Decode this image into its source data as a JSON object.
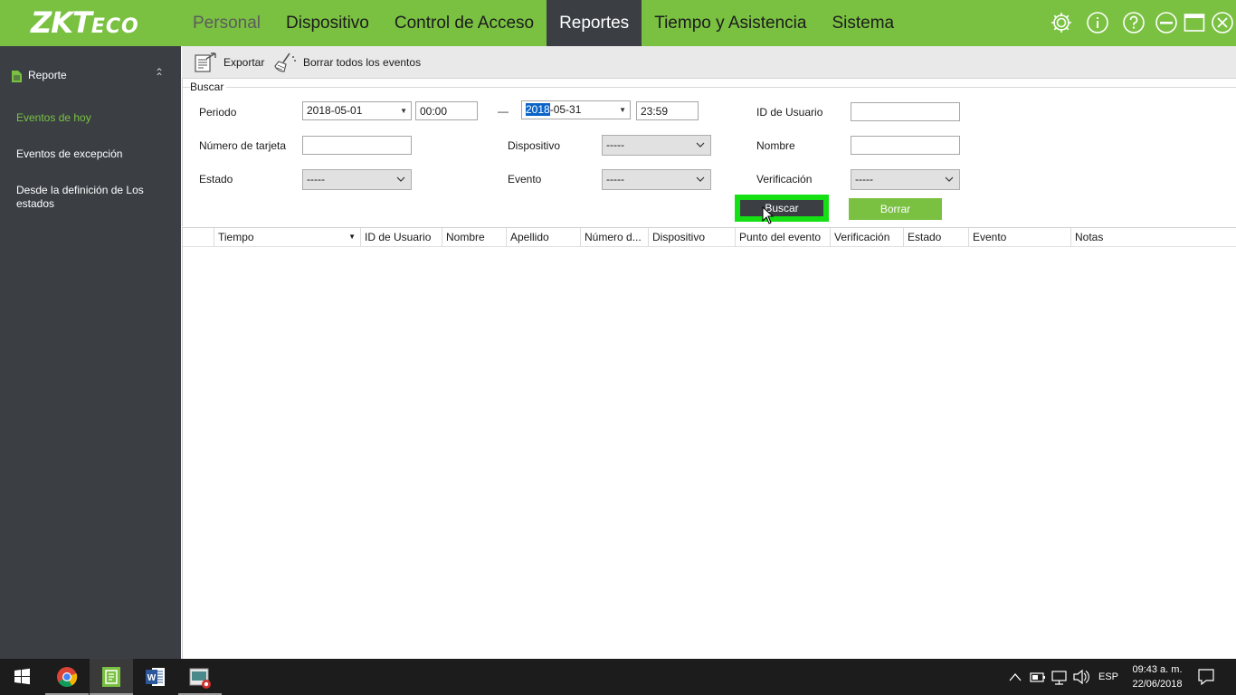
{
  "app": {
    "logo": {
      "main": "ZKT",
      "suffix": "ECO"
    },
    "accent_color": "#7ac142",
    "dark_color": "#3b3f44"
  },
  "nav": {
    "items": [
      {
        "label": "Personal"
      },
      {
        "label": "Dispositivo"
      },
      {
        "label": "Control de Acceso"
      },
      {
        "label": "Reportes"
      },
      {
        "label": "Tiempo y Asistencia"
      },
      {
        "label": "Sistema"
      }
    ],
    "active": "Reportes",
    "icons": [
      "gear-icon",
      "info-icon",
      "help-icon",
      "minimize-icon",
      "maximize-icon",
      "close-icon"
    ]
  },
  "sidebar": {
    "header": "Reporte",
    "items": [
      {
        "label": "Eventos de hoy",
        "active": true
      },
      {
        "label": "Eventos de excepción",
        "active": false
      },
      {
        "label": "Desde la definición de Los estados",
        "active": false
      }
    ]
  },
  "toolbar": {
    "export_label": "Exportar",
    "clear_label": "Borrar todos los eventos"
  },
  "search": {
    "legend": "Buscar",
    "periodo_label": "Periodo",
    "date_from": "2018-05-01",
    "time_from": "00:00",
    "range_dash": "—",
    "date_to_selected": "2018",
    "date_to_rest": "-05-31",
    "time_to": "23:59",
    "user_id_label": "ID de Usuario",
    "user_id_value": "",
    "card_label": "Número de tarjeta",
    "card_value": "",
    "device_label": "Dispositivo",
    "device_value": "-----",
    "name_label": "Nombre",
    "name_value": "",
    "state_label": "Estado",
    "state_value": "-----",
    "event_label": "Evento",
    "event_value": "-----",
    "verification_label": "Verificación",
    "verification_value": "-----",
    "search_button": "Buscar",
    "clear_button": "Borrar"
  },
  "table": {
    "columns": [
      "Tiempo",
      "ID de Usuario",
      "Nombre",
      "Apellido",
      "Número d...",
      "Dispositivo",
      "Punto del evento",
      "Verificación",
      "Estado",
      "Evento",
      "Notas"
    ],
    "rows": []
  },
  "taskbar": {
    "apps": [
      "windows-start-icon",
      "chrome-icon",
      "zkteco-app-icon",
      "word-icon",
      "recorder-icon"
    ],
    "language": "ESP",
    "time": "09:43 a. m.",
    "date": "22/06/2018"
  }
}
